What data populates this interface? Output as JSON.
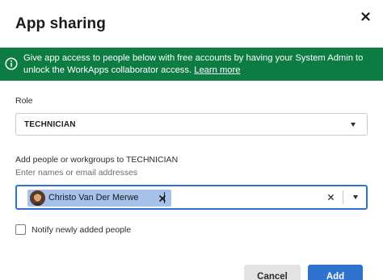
{
  "dialog": {
    "title": "App sharing",
    "close_icon": "close-icon"
  },
  "banner": {
    "icon": "info-circle-icon",
    "text_line1": "Give app access to people below with free accounts by having your System Admin to",
    "text_line2": "unlock the WorkApps collaborator access.",
    "link": "Learn more",
    "color": "#0d7c43"
  },
  "role": {
    "label": "Role",
    "selected": "TECHNICIAN"
  },
  "people": {
    "label": "Add people or workgroups to TECHNICIAN",
    "hint": "Enter names or email addresses",
    "chips": [
      {
        "name": "Christo Van Der Merwe",
        "avatar": "user-avatar-photo"
      }
    ],
    "input_value": ""
  },
  "notify": {
    "label": "Notify newly added people",
    "checked": false
  },
  "buttons": {
    "cancel": "Cancel",
    "add": "Add"
  },
  "colors": {
    "accent": "#2e72cf",
    "chip": "#a6c2ea"
  }
}
